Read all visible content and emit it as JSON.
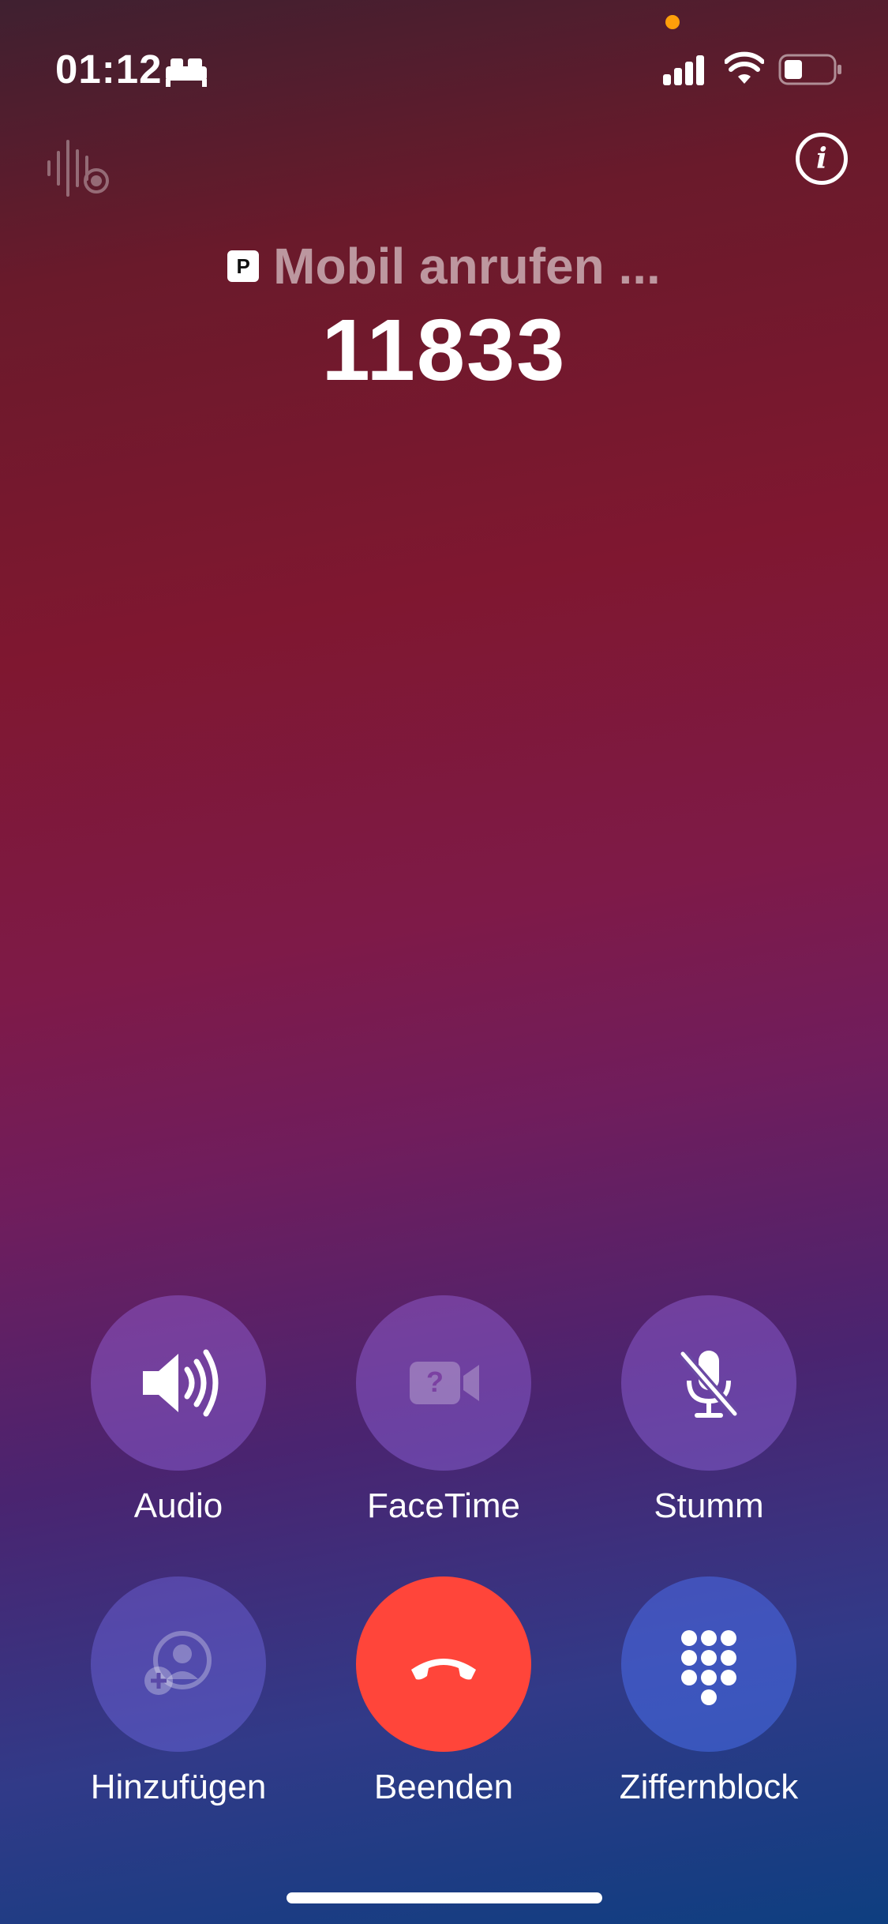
{
  "status_bar": {
    "time": "01:12",
    "icons": [
      "bed-icon",
      "signal-icon",
      "wifi-icon",
      "battery-icon"
    ],
    "indicator_color": "#ff9f0a"
  },
  "top_controls": {
    "left_icon": "waveform-icon",
    "right_icon": "info-icon"
  },
  "call": {
    "badge": "P",
    "status": "Mobil anrufen ...",
    "number": "11833"
  },
  "controls": [
    {
      "label": "Audio",
      "icon": "speaker-icon"
    },
    {
      "label": "FaceTime",
      "icon": "video-camera-icon"
    },
    {
      "label": "Stumm",
      "icon": "mic-off-icon"
    },
    {
      "label": "Hinzufügen",
      "icon": "add-person-icon"
    },
    {
      "label": "Beenden",
      "icon": "end-call-icon",
      "color": "#ff453a"
    },
    {
      "label": "Ziffernblock",
      "icon": "keypad-icon"
    }
  ]
}
